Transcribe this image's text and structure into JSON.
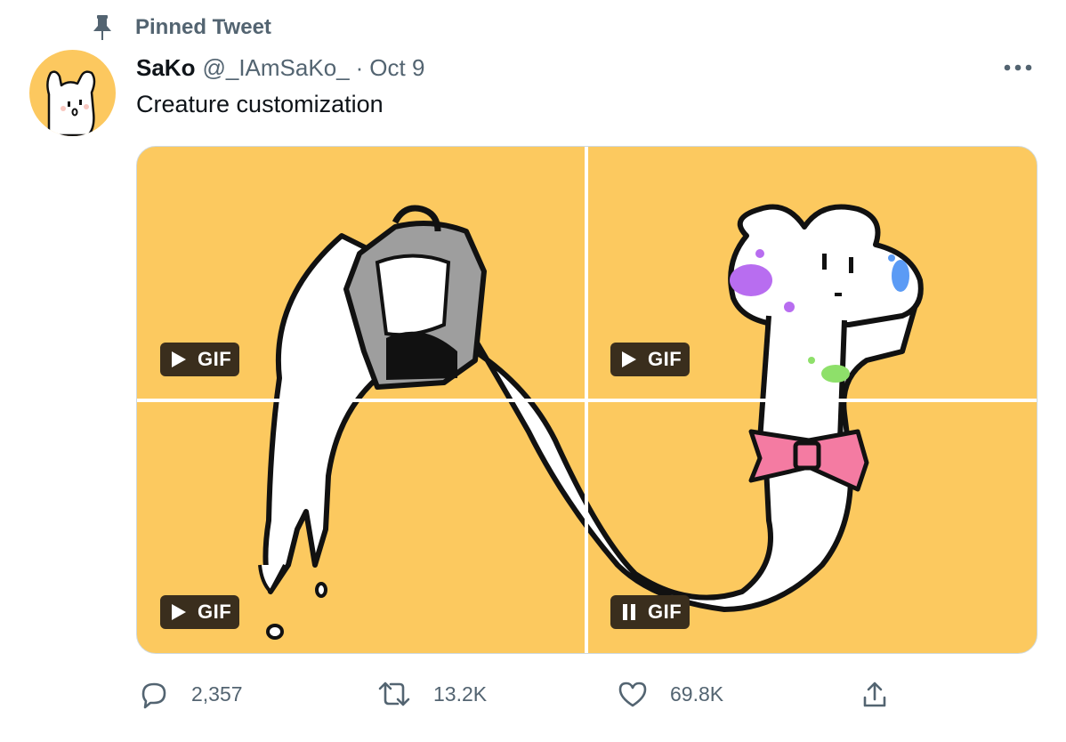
{
  "pinned": {
    "label": "Pinned Tweet",
    "icon": "pin-icon"
  },
  "author": {
    "display_name": "SaKo",
    "handle": "@_IAmSaKo_",
    "separator": "·",
    "date": "Oct 9",
    "avatar_color": "#fcc85f"
  },
  "tweet": {
    "text": "Creature customization"
  },
  "media": {
    "background": "#fcc95f",
    "badges": [
      {
        "icon": "play-icon",
        "label": "GIF"
      },
      {
        "icon": "play-icon",
        "label": "GIF"
      },
      {
        "icon": "play-icon",
        "label": "GIF"
      },
      {
        "icon": "pause-icon",
        "label": "GIF"
      }
    ]
  },
  "actions": {
    "reply": {
      "icon": "reply-icon",
      "count": "2,357"
    },
    "retweet": {
      "icon": "retweet-icon",
      "count": "13.2K"
    },
    "like": {
      "icon": "heart-icon",
      "count": "69.8K"
    },
    "share": {
      "icon": "share-icon"
    }
  },
  "colors": {
    "text": "#0f1419",
    "secondary": "#536471",
    "media_bg": "#fcc95f"
  }
}
